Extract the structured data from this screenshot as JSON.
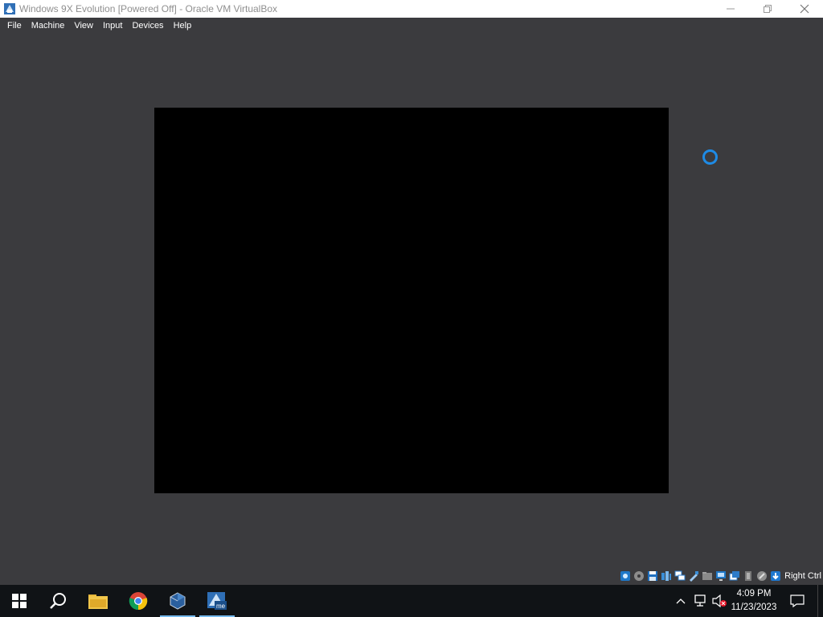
{
  "window": {
    "title": "Windows 9X Evolution [Powered Off] - Oracle VM VirtualBox",
    "controls": {
      "minimize": "minimize-icon",
      "maximize": "restore-icon",
      "close": "close-icon"
    }
  },
  "menu": {
    "items": [
      "File",
      "Machine",
      "View",
      "Input",
      "Devices",
      "Help"
    ]
  },
  "statusbar": {
    "icons": [
      "hard-disk-icon",
      "optical-drive-icon",
      "floppy-icon",
      "audio-icon",
      "network-icon",
      "usb-icon",
      "shared-folders-icon",
      "display-icon",
      "recording-icon",
      "cpu-icon",
      "mouse-integration-icon",
      "keyboard-icon"
    ],
    "host_key": "Right Ctrl"
  },
  "taskbar": {
    "pinned": [
      "start-icon",
      "search-icon",
      "file-explorer-icon",
      "chrome-icon",
      "virtualbox-icon",
      "vm-window-icon"
    ],
    "clock": {
      "time": "4:09 PM",
      "date": "11/23/2023"
    }
  },
  "colors": {
    "background": "#3b3b3e",
    "vm_screen": "#000000",
    "taskbar": "#101316",
    "accent": "#1e8be6"
  }
}
